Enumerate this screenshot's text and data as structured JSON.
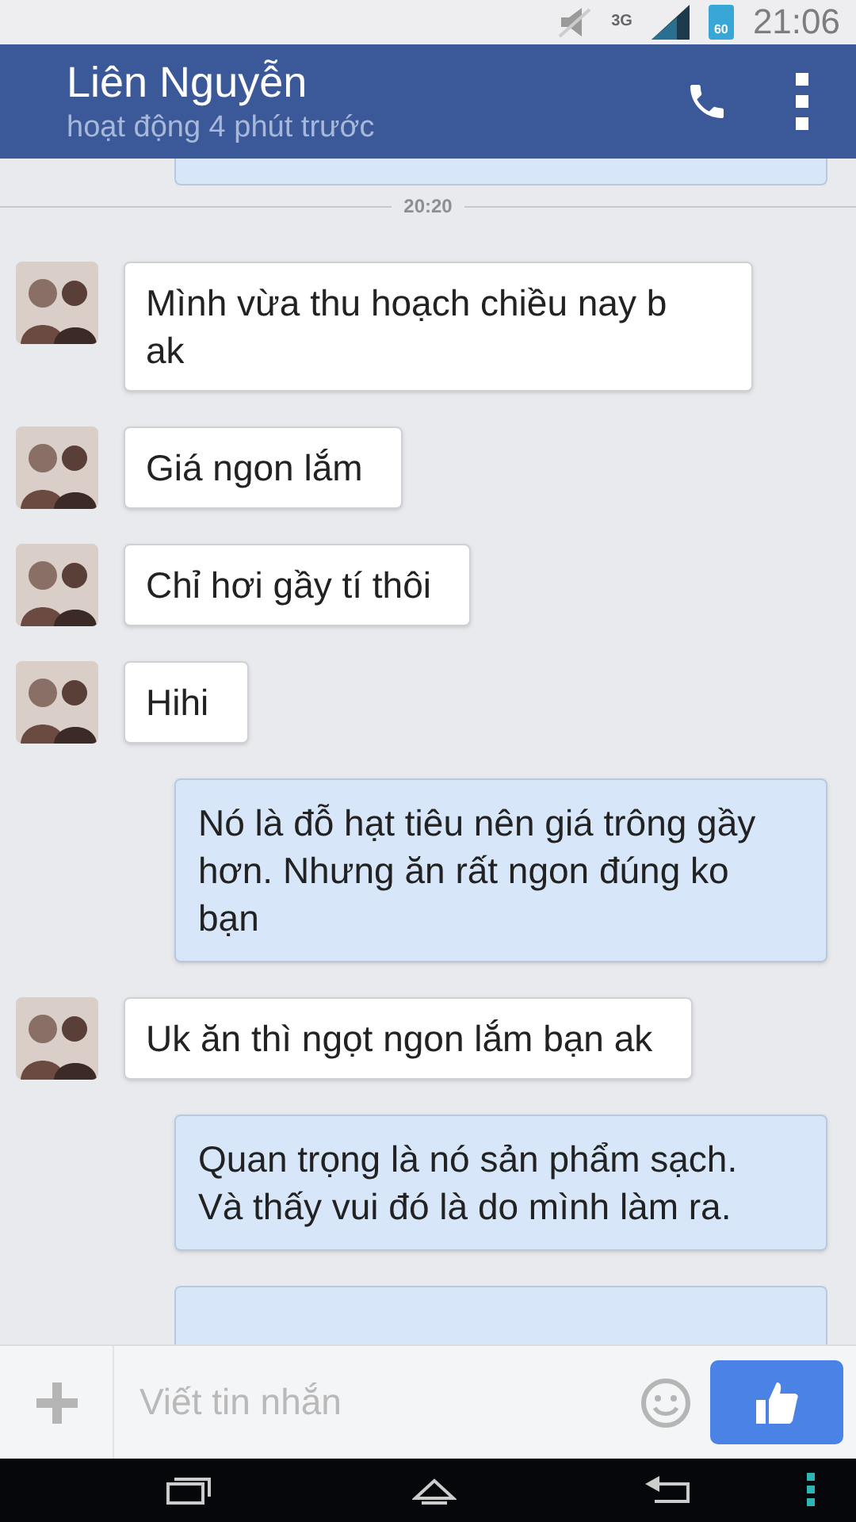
{
  "status_bar": {
    "network": "3G",
    "battery": "60",
    "time": "21:06"
  },
  "header": {
    "name": "Liên Nguyễn",
    "status": "hoạt động 4 phút trước"
  },
  "timestamp": "20:20",
  "messages": [
    {
      "kind": "incoming",
      "text": "Mình vừa thu hoạch chiều nay b ak"
    },
    {
      "kind": "incoming",
      "text": "Giá ngon lắm"
    },
    {
      "kind": "incoming",
      "text": "Chỉ hơi gầy tí thôi"
    },
    {
      "kind": "incoming",
      "text": "Hihi"
    },
    {
      "kind": "outgoing",
      "text": "Nó là đỗ hạt tiêu nên giá trông gầy hơn. Nhưng ăn rất ngon đúng ko bạn"
    },
    {
      "kind": "incoming",
      "text": "Uk ăn thì ngọt ngon lắm bạn ak"
    },
    {
      "kind": "outgoing",
      "text": "Quan trọng là nó sản phẩm sạch. Và thấy vui đó là do mình làm ra."
    }
  ],
  "composer": {
    "placeholder": "Viết tin nhắn"
  }
}
